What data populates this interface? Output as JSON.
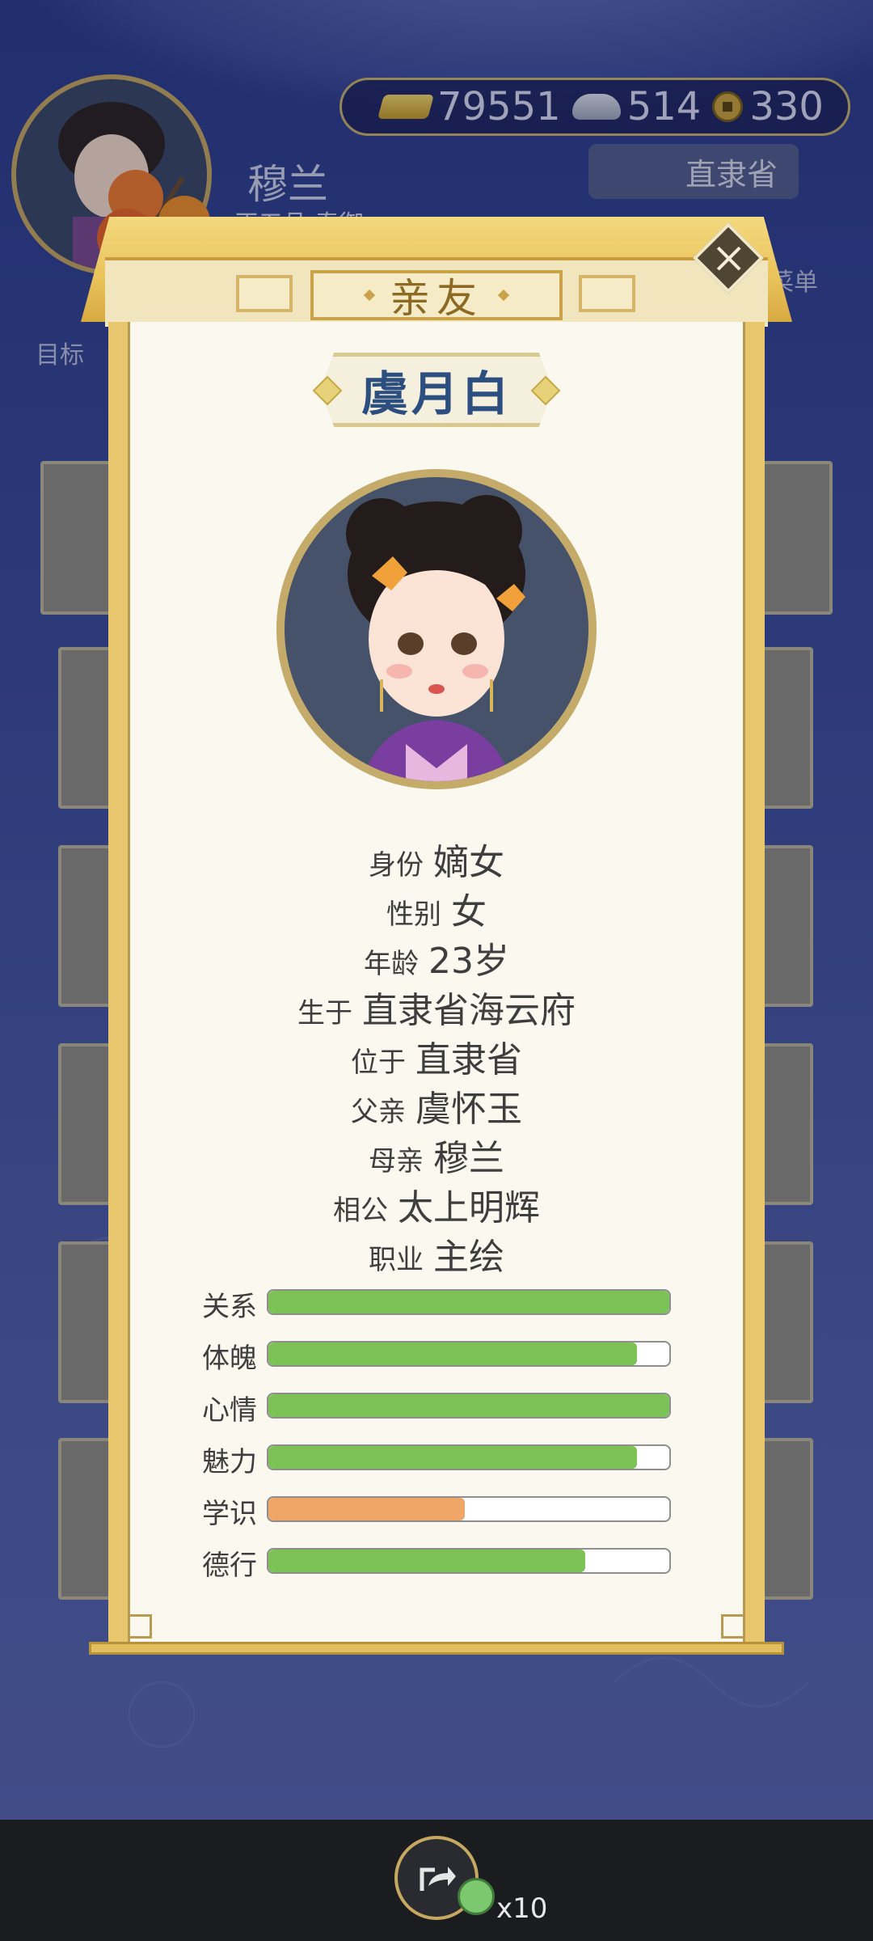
{
  "player": {
    "name": "穆兰",
    "rank": "正五品·奉御",
    "province": "直隶省"
  },
  "currency": {
    "gold": "79551",
    "silver": "514",
    "coins": "330"
  },
  "hud": {
    "goal_label": "目标",
    "menu_label": "菜单"
  },
  "dialog": {
    "title": "亲友",
    "person_name": "虞月白",
    "info": [
      {
        "label": "身份",
        "value": "嫡女"
      },
      {
        "label": "性别",
        "value": "女"
      },
      {
        "label": "年龄",
        "value": "23岁"
      },
      {
        "label": "生于",
        "value": "直隶省海云府"
      },
      {
        "label": "位于",
        "value": "直隶省"
      },
      {
        "label": "父亲",
        "value": "虞怀玉"
      },
      {
        "label": "母亲",
        "value": "穆兰"
      },
      {
        "label": "相公",
        "value": "太上明辉"
      },
      {
        "label": "职业",
        "value": "主绘"
      }
    ],
    "stats": [
      {
        "label": "关系",
        "level": 1.0,
        "color": "#7cc257"
      },
      {
        "label": "体魄",
        "level": 0.92,
        "color": "#7cc257"
      },
      {
        "label": "心情",
        "level": 1.0,
        "color": "#7cc257"
      },
      {
        "label": "魅力",
        "level": 0.92,
        "color": "#7cc257"
      },
      {
        "label": "学识",
        "level": 0.49,
        "color": "#f0a666"
      },
      {
        "label": "德行",
        "level": 0.79,
        "color": "#7cc257"
      }
    ]
  },
  "bottom": {
    "share_icon": "share-arrow-icon",
    "count": "x10"
  },
  "colors": {
    "accent_gold": "#c9a24a",
    "name_blue": "#2c4f80",
    "bar_green": "#7cc257",
    "bar_orange": "#f0a666"
  }
}
